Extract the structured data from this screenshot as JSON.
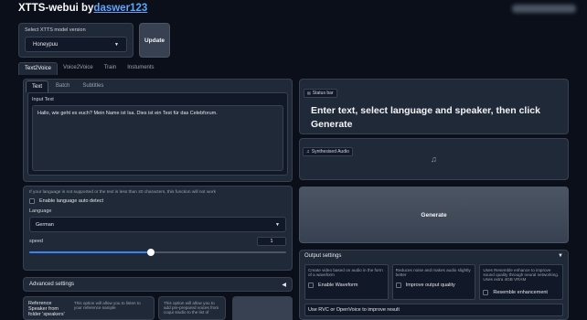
{
  "header": {
    "title": "XTTS-webui by",
    "author_link": "daswer123",
    "blurred_text": ""
  },
  "model": {
    "label": "Select XTTS model version",
    "selected": "Honeypuu",
    "update_button": "Update"
  },
  "main_tabs": [
    "Text2Voice",
    "Voice2Voice",
    "Train",
    "Instuments"
  ],
  "sub_tabs": [
    "Text",
    "Batch",
    "Subtitles"
  ],
  "input": {
    "label": "Input Text",
    "value": "Hallo, wie geht es euch? Mein Name ist Isa. Dies ist ein Test für das Celebforum."
  },
  "language": {
    "note": "If your language is not supported or the text is less than 20 characters, this function will not work",
    "auto_detect": "Enable language auto detect",
    "label": "Language",
    "selected": "German"
  },
  "speed": {
    "label": "speed",
    "value": "1",
    "fraction": 0.5
  },
  "advanced": {
    "label": "Advanced settings"
  },
  "reference": {
    "label": "Reference Speaker from folder 'speakers'",
    "desc1": "This option will allow you to listen to your reference sample",
    "desc2": "This option will allow you to add pre-prepared voices from coqui studio to the list of"
  },
  "status": {
    "tag": "Status bar",
    "message": "Enter text, select language and speaker, then click Generate"
  },
  "audio": {
    "tag": "Synthesised Audio"
  },
  "generate": {
    "label": "Generate"
  },
  "output": {
    "label": "Output settings",
    "col1_desc": "Create video based on audio in the form of a waveform",
    "col1_check": "Enable Waveform",
    "col2_desc": "Reduces noise and makes audio slightly better",
    "col2_check": "Improve output quality",
    "col3_desc": "Uses Resemble enhance to improve sound quality through neural networking. Uses extra 4GB VRAM",
    "col3_check": "Resemble enhancement",
    "rvc": "Use RVC or OpenVoice to improve result"
  },
  "colors": {
    "accent": "#3b82f6",
    "link": "#60a5fa",
    "bg": "#0b0f19",
    "panel": "#1f2937"
  }
}
